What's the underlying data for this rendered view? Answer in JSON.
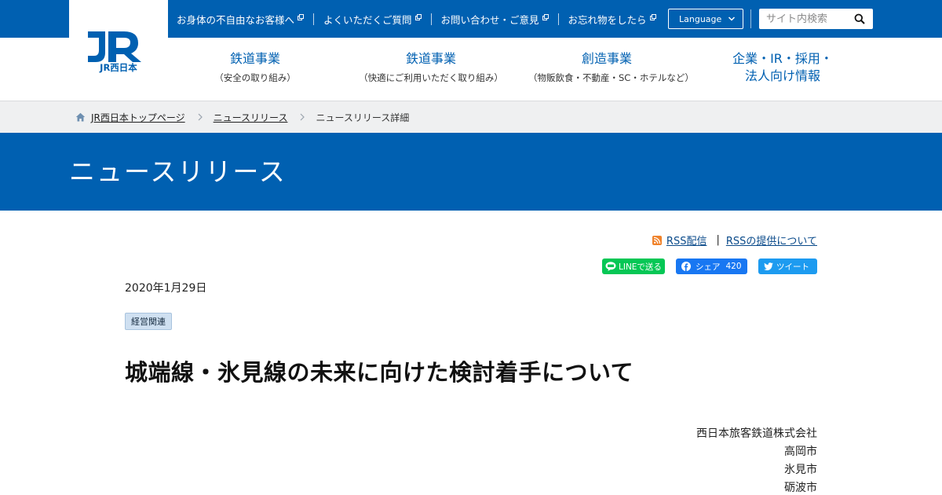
{
  "brand": {
    "logo_text": "JR西日本",
    "primary_color": "#0060b1"
  },
  "utility_nav": {
    "links": [
      {
        "label": "お身体の不自由なお客様へ",
        "icon": "external-link-icon"
      },
      {
        "label": "よくいただくご質問",
        "icon": "external-link-icon"
      },
      {
        "label": "お問い合わせ・ご意見",
        "icon": "external-link-icon"
      },
      {
        "label": "お忘れ物をしたら",
        "icon": "external-link-icon"
      }
    ],
    "language_label": "Language",
    "search_placeholder": "サイト内検索"
  },
  "main_nav": {
    "items": [
      {
        "title": "鉄道事業",
        "subtitle": "（安全の取り組み）"
      },
      {
        "title": "鉄道事業",
        "subtitle": "（快適にご利用いただく取り組み）"
      },
      {
        "title": "創造事業",
        "subtitle": "（物販飲食・不動産・SC・ホテルなど）"
      },
      {
        "title_line1": "企業・IR・採用・",
        "title_line2": "法人向け情報"
      }
    ]
  },
  "breadcrumb": {
    "home": "JR西日本トップページ",
    "parent": "ニュースリリース",
    "current": "ニュースリリース詳細"
  },
  "banner": {
    "title": "ニュースリリース"
  },
  "article": {
    "rss_label": "RSS配信",
    "rss_about_label": "RSSの提供について",
    "share": {
      "line_label": "LINEで送る",
      "facebook_label": "シェア",
      "facebook_count": "420",
      "twitter_label": "ツイート"
    },
    "date": "2020年1月29日",
    "category": "経営関連",
    "headline": "城端線・氷見線の未来に向けた検討着手について",
    "issuers": [
      "西日本旅客鉄道株式会社",
      "高岡市",
      "氷見市",
      "砺波市"
    ]
  }
}
